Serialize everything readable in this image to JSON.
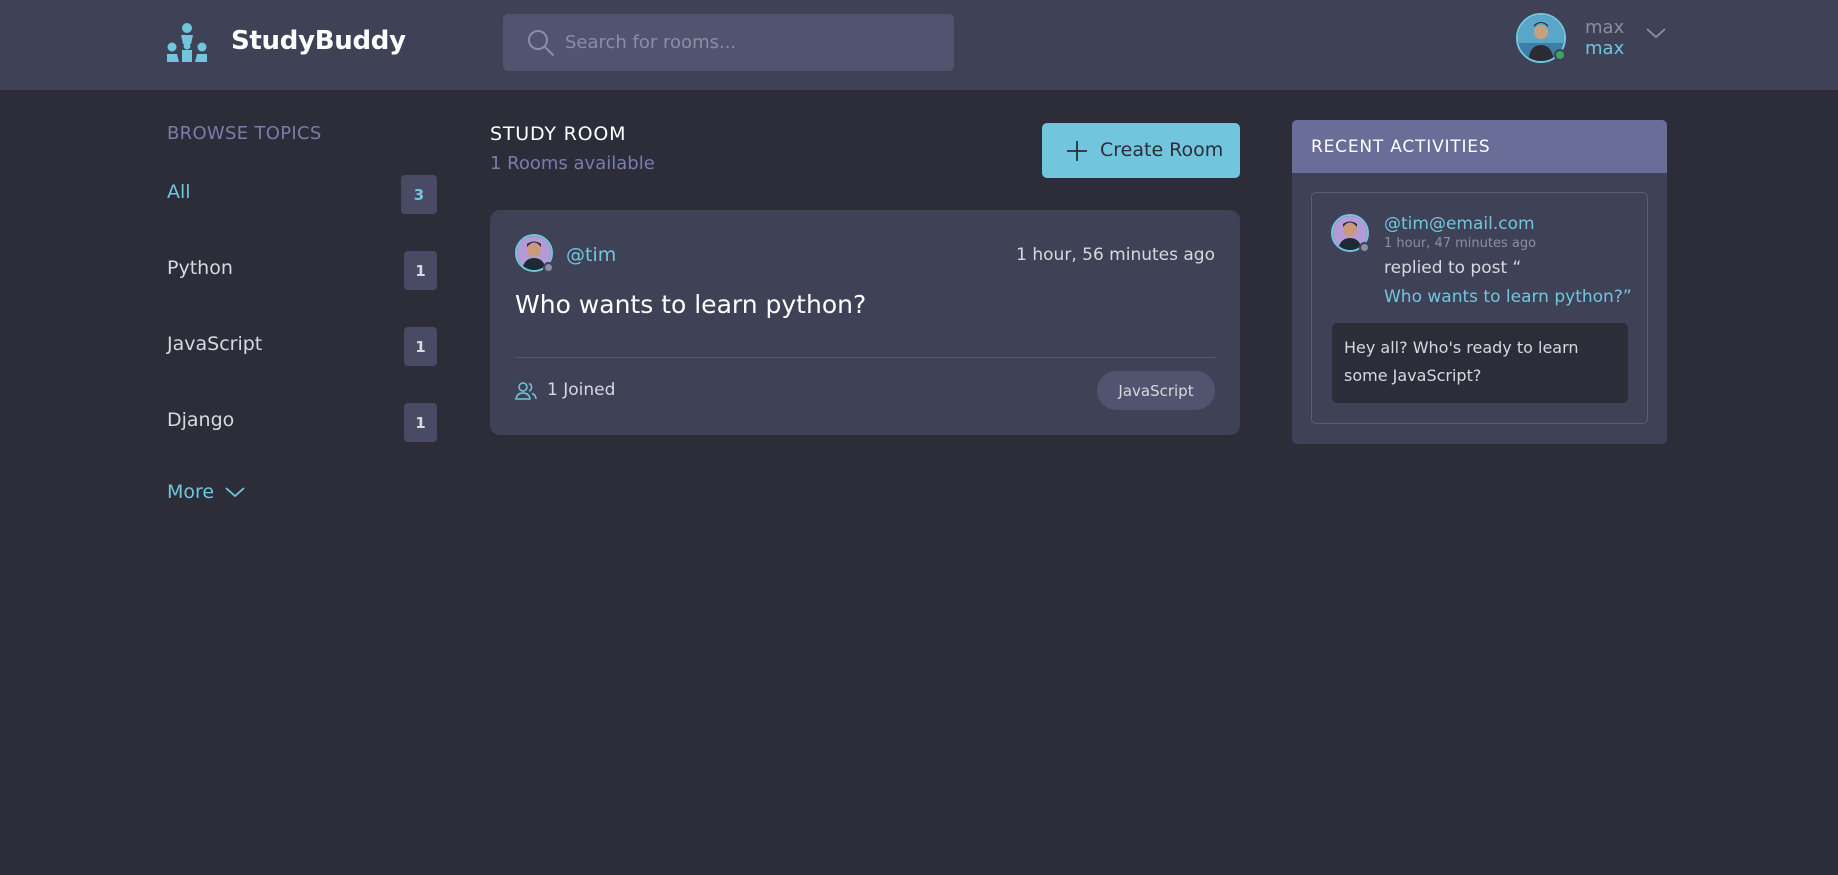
{
  "header": {
    "brand": "StudyBuddy",
    "search_placeholder": "Search for rooms...",
    "user": {
      "name": "max",
      "handle": "max",
      "status_color": "#3ba55c"
    }
  },
  "sidebar": {
    "title": "BROWSE TOPICS",
    "topics": [
      {
        "label": "All",
        "count": "3",
        "active": true
      },
      {
        "label": "Python",
        "count": "1"
      },
      {
        "label": "JavaScript",
        "count": "1"
      },
      {
        "label": "Django",
        "count": "1"
      }
    ],
    "more_label": "More"
  },
  "main": {
    "title": "STUDY ROOM",
    "subtitle": "1 Rooms available",
    "create_label": "Create Room",
    "rooms": [
      {
        "host": "@tim",
        "time": "1 hour, 56 minutes ago",
        "name": "Who wants to learn python?",
        "joined": "1 Joined",
        "topic": "JavaScript"
      }
    ]
  },
  "activities": {
    "title": "RECENT ACTIVITIES",
    "items": [
      {
        "user": "@tim@email.com",
        "time": "1 hour, 47 minutes ago",
        "action": "replied to post “",
        "post": "Who wants to learn python?”",
        "message": "Hey all? Who's ready to learn some JavaScript?"
      }
    ]
  },
  "colors": {
    "background": "#2d2d39",
    "surface": "#3f4156",
    "accent": "#71c6dd",
    "muted": "#7a7cab",
    "activities_header": "#696d97"
  }
}
